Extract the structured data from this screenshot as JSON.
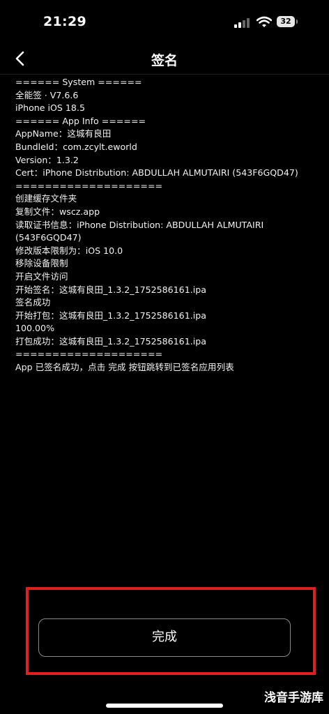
{
  "status_bar": {
    "time": "21:29",
    "battery": "32"
  },
  "nav": {
    "title": "签名",
    "back_icon": "chevron-left-icon"
  },
  "log_lines": [
    "====== System ======",
    "全能签 · V7.6.6",
    "iPhone iOS 18.5",
    "====== App Info ======",
    "AppName：这城有良田",
    "BundleId：com.zcylt.eworld",
    "Version：1.3.2",
    "Cert：iPhone Distribution: ABDULLAH ALMUTAIRI (543F6GQD47)",
    "====================",
    "创建缓存文件夹",
    "复制文件：wscz.app",
    "读取证书信息：iPhone Distribution: ABDULLAH ALMUTAIRI (543F6GQD47)",
    "修改版本限制为：iOS 10.0",
    "移除设备限制",
    "开启文件访问",
    "开始签名：这城有良田_1.3.2_1752586161.ipa",
    "签名成功",
    "开始打包：这城有良田_1.3.2_1752586161.ipa",
    "100.00%",
    "打包成功：这城有良田_1.3.2_1752586161.ipa",
    "====================",
    "App 已签名成功，点击 完成 按钮跳转到已签名应用列表"
  ],
  "done_button": {
    "label": "完成"
  },
  "watermark": "浅音手游库",
  "colors": {
    "highlight": "#e21f1f",
    "background": "#000000"
  }
}
